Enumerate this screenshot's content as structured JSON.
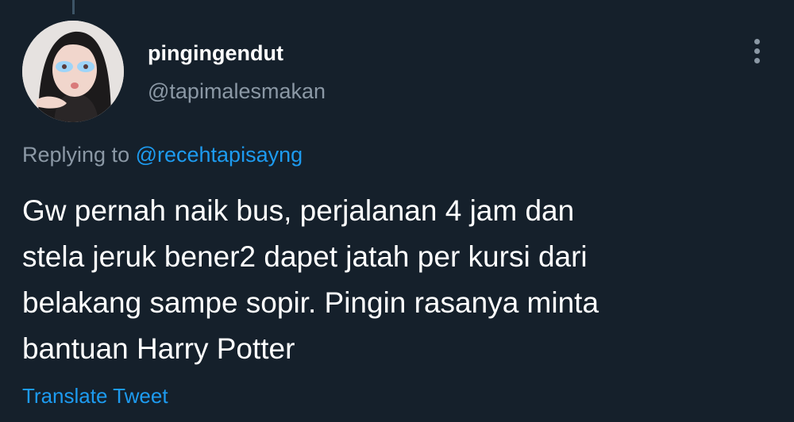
{
  "tweet": {
    "user": {
      "display_name": "pingingendut",
      "handle": "@tapimalesmakan",
      "avatar_icon": "profile-photo"
    },
    "replying_prefix": "Replying to ",
    "replying_to": "@recehtapisayng",
    "text_lines": [
      "Gw pernah naik bus, perjalanan 4 jam dan",
      "stela jeruk bener2 dapet jatah per kursi dari",
      "belakang sampe sopir. Pingin rasanya minta",
      "bantuan Harry Potter"
    ],
    "translate_label": "Translate Tweet",
    "more_icon": "more-vertical-icon"
  },
  "colors": {
    "background": "#15202b",
    "primary_text": "#ffffff",
    "secondary_text": "#8b98a5",
    "accent": "#1d9bf0",
    "thread_line": "#3d5466"
  }
}
